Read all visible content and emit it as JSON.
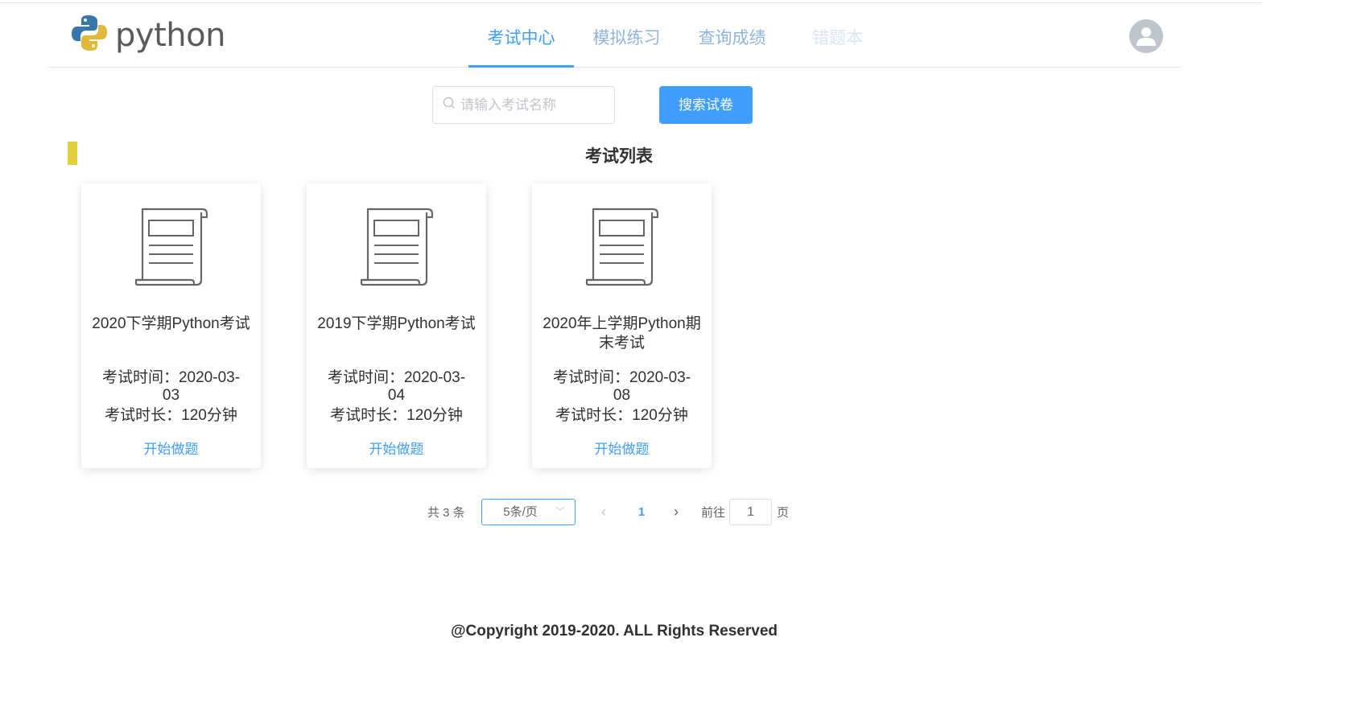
{
  "app": {
    "logo_text": "python",
    "colors": {
      "accent": "#409eff",
      "section_marker": "#e0d040",
      "python_blue": "#3776ab",
      "python_yellow": "#ffd43b"
    }
  },
  "nav": {
    "items": [
      {
        "label": "考试中心"
      },
      {
        "label": "模拟练习"
      },
      {
        "label": "查询成绩"
      },
      {
        "label": "错题本"
      }
    ],
    "active_index": 0
  },
  "user": {
    "avatar_icon": "user-avatar-icon"
  },
  "search": {
    "placeholder": "请输入考试名称",
    "value": "",
    "icon": "search-icon",
    "button_label": "搜索试卷"
  },
  "section": {
    "title": "考试列表"
  },
  "exams": [
    {
      "title": "2020下学期Python考试",
      "time": "考试时间：2020-03-03",
      "duration": "考试时长：120分钟",
      "action": "开始做题",
      "icon": "exam-paper-icon"
    },
    {
      "title": "2019下学期Python考试",
      "time": "考试时间：2020-03-04",
      "duration": "考试时长：120分钟",
      "action": "开始做题",
      "icon": "exam-paper-icon"
    },
    {
      "title": "2020年上学期Python期末考试",
      "time": "考试时间：2020-03-08",
      "duration": "考试时长：120分钟",
      "action": "开始做题",
      "icon": "exam-paper-icon"
    }
  ],
  "pagination": {
    "total_text": "共 3 条",
    "page_size": "5条/页",
    "current_page": "1",
    "goto_label": "前往",
    "goto_value": "1",
    "page_unit": "页"
  },
  "footer": {
    "copyright": "@Copyright 2019-2020. ALL Rights Reserved"
  }
}
